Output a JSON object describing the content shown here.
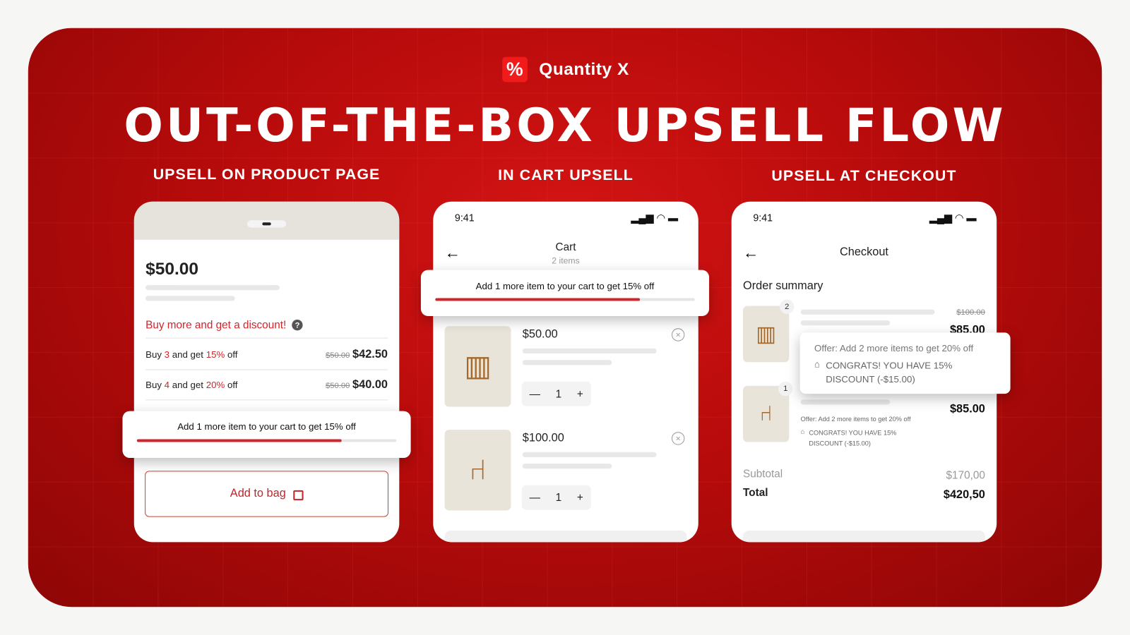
{
  "brand": {
    "name": "Quantity X",
    "logo_glyph": "%"
  },
  "headline": "OUT-OF-THE-BOX UPSELL FLOW",
  "sections": [
    "UPSELL ON PRODUCT PAGE",
    "IN CART UPSELL",
    "UPSELL AT CHECKOUT"
  ],
  "colors": {
    "accent": "#d0252b",
    "banner": "#b80b0b"
  },
  "product": {
    "price": "$50.00",
    "discount_heading": "Buy more and get a discount!",
    "tiers": [
      {
        "pre": "Buy ",
        "qty": "3",
        "mid": " and get ",
        "pct": "15%",
        "post": " off",
        "old": "$50.00",
        "new": "$42.50"
      },
      {
        "pre": "Buy ",
        "qty": "4",
        "mid": " and get ",
        "pct": "20%",
        "post": " off",
        "old": "$50.00",
        "new": "$40.00"
      }
    ],
    "upsell_message": "Add 1 more item to your cart to get 15% off",
    "progress": 0.79,
    "add_to_bag": "Add to bag"
  },
  "cart": {
    "time": "9:41",
    "title": "Cart",
    "subtitle": "2 items",
    "upsell_message": "Add 1 more item to your cart to get 15% off",
    "progress": 0.79,
    "items": [
      {
        "price": "$50.00",
        "qty": "1"
      },
      {
        "price": "$100.00",
        "qty": "1"
      }
    ]
  },
  "checkout": {
    "time": "9:41",
    "title": "Checkout",
    "order_summary": "Order summary",
    "items": [
      {
        "badge": "2",
        "old": "$100.00",
        "new": "$85.00"
      },
      {
        "badge": "1",
        "new": "$85.00",
        "offer": "Offer: Add 2 more items to get 20% off",
        "congrats": "CONGRATS! YOU HAVE 15% DISCOUNT (-$15.00)"
      }
    ],
    "popup": {
      "offer": "Offer: Add 2 more items to get 20% off",
      "congrats": "CONGRATS! YOU HAVE 15% DISCOUNT (-$15.00)"
    },
    "subtotal_label": "Subtotal",
    "subtotal": "$170,00",
    "total_label": "Total",
    "total": "$420,50"
  }
}
